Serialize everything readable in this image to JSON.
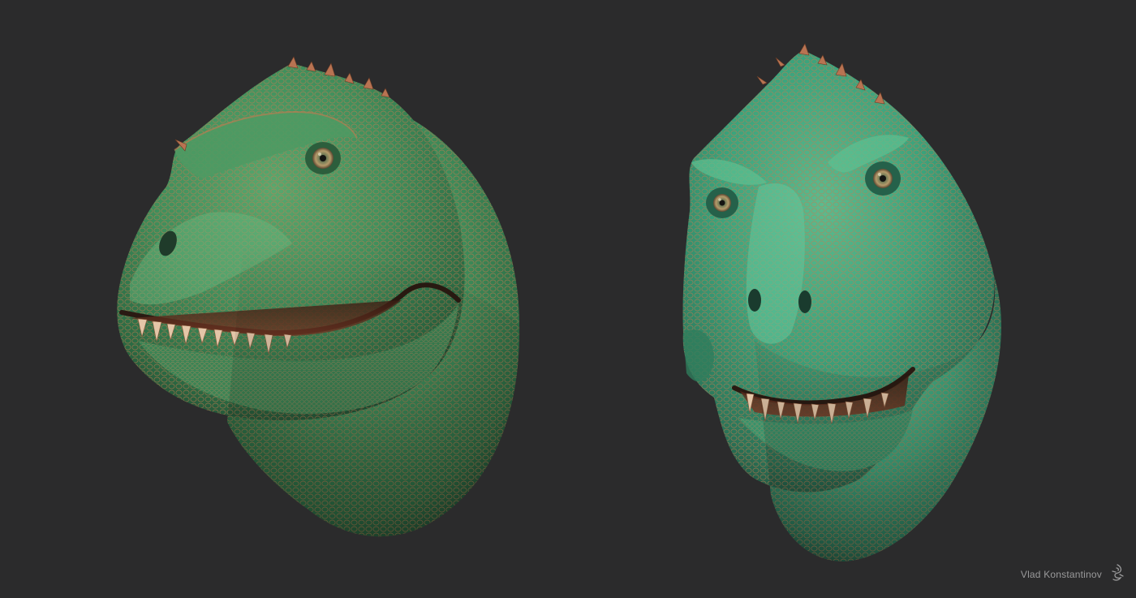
{
  "artist": {
    "name": "Vlad Konstantinov",
    "logo_icon": "dragon-signature-icon"
  },
  "scene": {
    "background_color": "#2b2b2c",
    "subject": "two trex head sculpt renders",
    "skin_colors": {
      "green": "#3f8f5c",
      "teal": "#3aa37c",
      "orange": "#c47a50",
      "shadow": "#1f3b2a"
    }
  }
}
